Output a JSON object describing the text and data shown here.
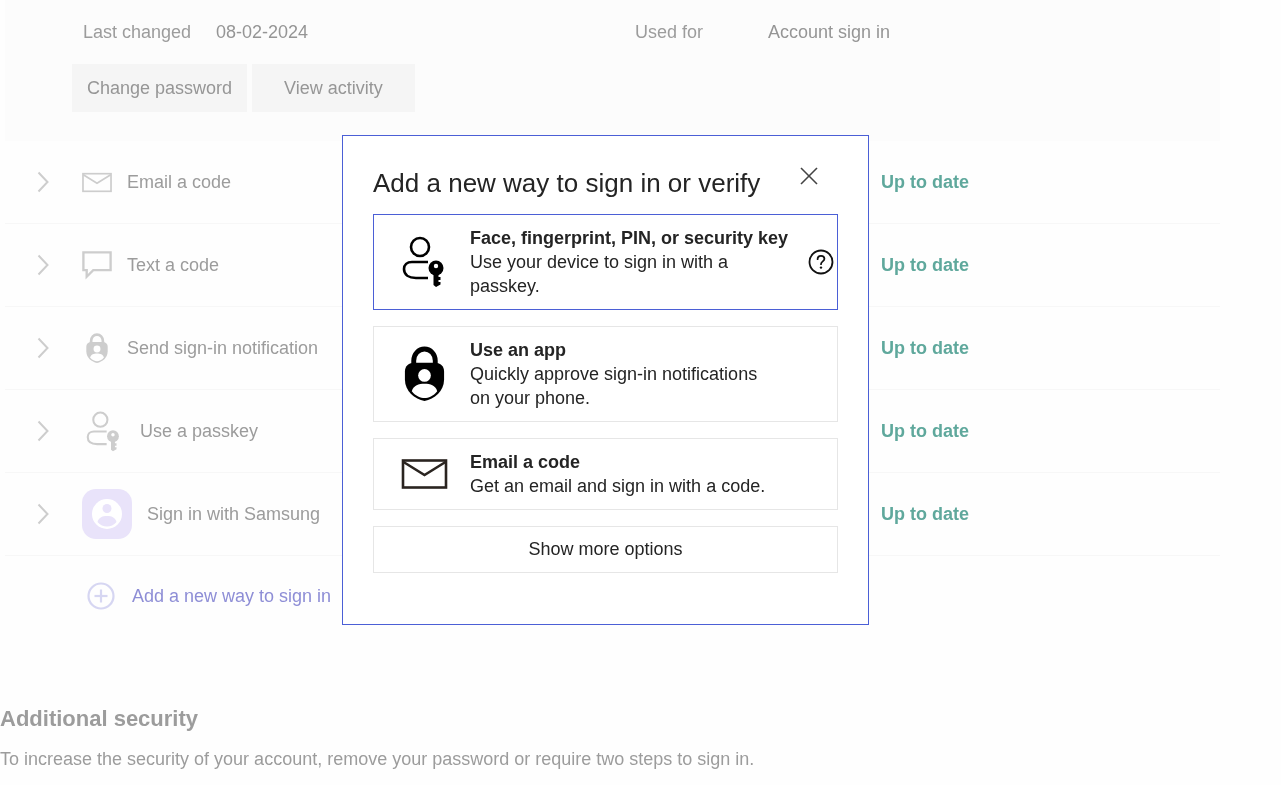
{
  "password_card": {
    "last_changed_label": "Last changed",
    "last_changed_value": "08-02-2024",
    "used_for_label": "Used for",
    "used_for_value": "Account sign in",
    "buttons": [
      "Change password",
      "View activity"
    ]
  },
  "methods": [
    {
      "kind": "email",
      "label": "Email a code",
      "status": "Up to date",
      "expanded": false
    },
    {
      "kind": "text",
      "label": "Text a code",
      "status": "Up to date",
      "expanded": false
    },
    {
      "kind": "notification",
      "label": "Send sign-in notification",
      "status": "Up to date",
      "expanded": false
    },
    {
      "kind": "passkey",
      "label": "Use a passkey",
      "status": "Up to date",
      "expanded": false
    },
    {
      "kind": "samsung",
      "label": "Sign in with Samsung",
      "status": "Up to date",
      "expanded": false
    }
  ],
  "add_method_link": "Add a new way to sign in",
  "additional_security": {
    "title": "Additional security",
    "description": "To increase the security of your account, remove your password or require two steps to sign in."
  },
  "dialog": {
    "title": "Add a new way to sign in or verify",
    "options": [
      {
        "kind": "passkey",
        "title": "Face, fingerprint, PIN, or security key",
        "description": "Use your device to sign in with a passkey.",
        "selected": true,
        "help": true
      },
      {
        "kind": "app",
        "title": "Use an app",
        "description": "Quickly approve sign-in notifications on your phone.",
        "selected": false,
        "help": false
      },
      {
        "kind": "email",
        "title": "Email a code",
        "description": "Get an email and sign in with a code.",
        "selected": false,
        "help": false
      }
    ],
    "more_button": "Show more options"
  }
}
